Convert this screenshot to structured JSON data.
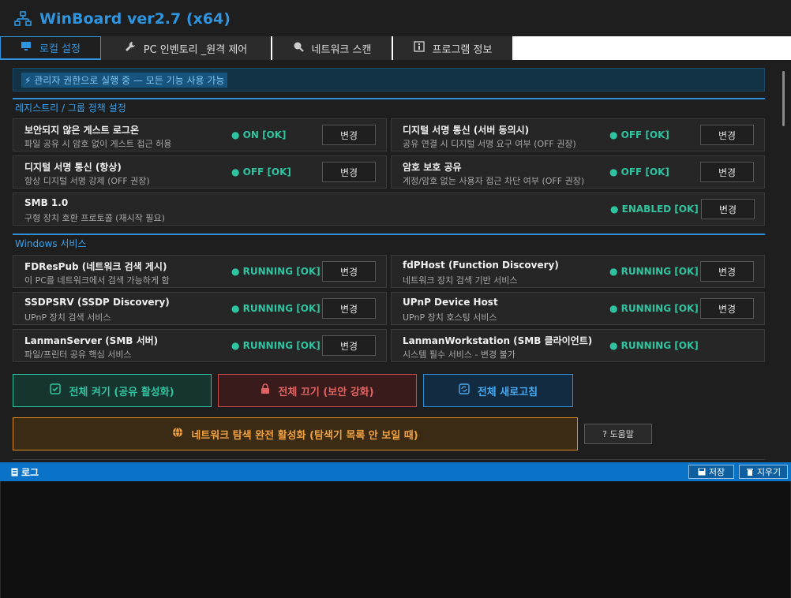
{
  "app": {
    "title": "WinBoard ver2.7 (x64)",
    "accent_color": "#2f95e0"
  },
  "tabs": [
    {
      "label": "로컬 설정",
      "icon": "monitor-icon"
    },
    {
      "label": "PC 인벤토리 _원격 제어",
      "icon": "wrench-icon"
    },
    {
      "label": "네트워크 스캔",
      "icon": "search-icon"
    },
    {
      "label": "프로그램 정보",
      "icon": "info-icon"
    }
  ],
  "banner": {
    "text": "⚡ 관리자 권한으로 실행 중 — 모든 기능 사용 가능"
  },
  "sections": {
    "registry": {
      "title": "레지스트리 / 그룹 정책 설정",
      "items": [
        {
          "name": "보안되지 않은 게스트 로그온",
          "desc": "파일 공유 시 암호 없이 게스트 접근 허용",
          "status": "● ON [OK]",
          "button": "변경"
        },
        {
          "name": "디지털 서명 통신 (서버 동의시)",
          "desc": "공유 연결 시 디지털 서명 요구 여부 (OFF 권장)",
          "status": "● OFF [OK]",
          "button": "변경"
        },
        {
          "name": "디지털 서명 통신 (항상)",
          "desc": "항상 디지털 서명 강제 (OFF 권장)",
          "status": "● OFF [OK]",
          "button": "변경"
        },
        {
          "name": "암호 보호 공유",
          "desc": "계정/암호 없는 사용자 접근 차단 여부 (OFF 권장)",
          "status": "● OFF [OK]",
          "button": "변경"
        },
        {
          "name": "SMB 1.0",
          "desc": "구형 장치 호환 프로토콜 (재시작 필요)",
          "status": "● ENABLED [OK]",
          "button": "변경"
        }
      ]
    },
    "services": {
      "title": "Windows 서비스",
      "items": [
        {
          "name": "FDResPub (네트워크 검색 게시)",
          "desc": "이 PC를 네트워크에서 검색 가능하게 함",
          "status": "● RUNNING [OK]",
          "button": "변경"
        },
        {
          "name": "fdPHost (Function Discovery)",
          "desc": "네트워크 장치 검색 기반 서비스",
          "status": "● RUNNING [OK]",
          "button": "변경"
        },
        {
          "name": "SSDPSRV (SSDP Discovery)",
          "desc": "UPnP 장치 검색 서비스",
          "status": "● RUNNING [OK]",
          "button": "변경"
        },
        {
          "name": "UPnP Device Host",
          "desc": "UPnP 장치 호스팅 서비스",
          "status": "● RUNNING [OK]",
          "button": "변경"
        },
        {
          "name": "LanmanServer (SMB 서버)",
          "desc": "파일/프린터 공유 핵심 서비스",
          "status": "● RUNNING [OK]",
          "button": "변경"
        },
        {
          "name": "LanmanWorkstation (SMB 클라이언트)",
          "desc": "시스템 필수 서비스 - 변경 불가",
          "status": "● RUNNING [OK]"
        }
      ]
    }
  },
  "actions": {
    "all_on": "전체 켜기 (공유 활성화)",
    "all_off": "전체 끄기 (보안 강화)",
    "refresh": "전체 새로고침",
    "discovery": "네트워크 탐색 완전 활성화  (탐색기 목록 안 보일 때)",
    "help": "? 도움말"
  },
  "log": {
    "title": "로그",
    "save": "저장",
    "clear": "지우기"
  }
}
